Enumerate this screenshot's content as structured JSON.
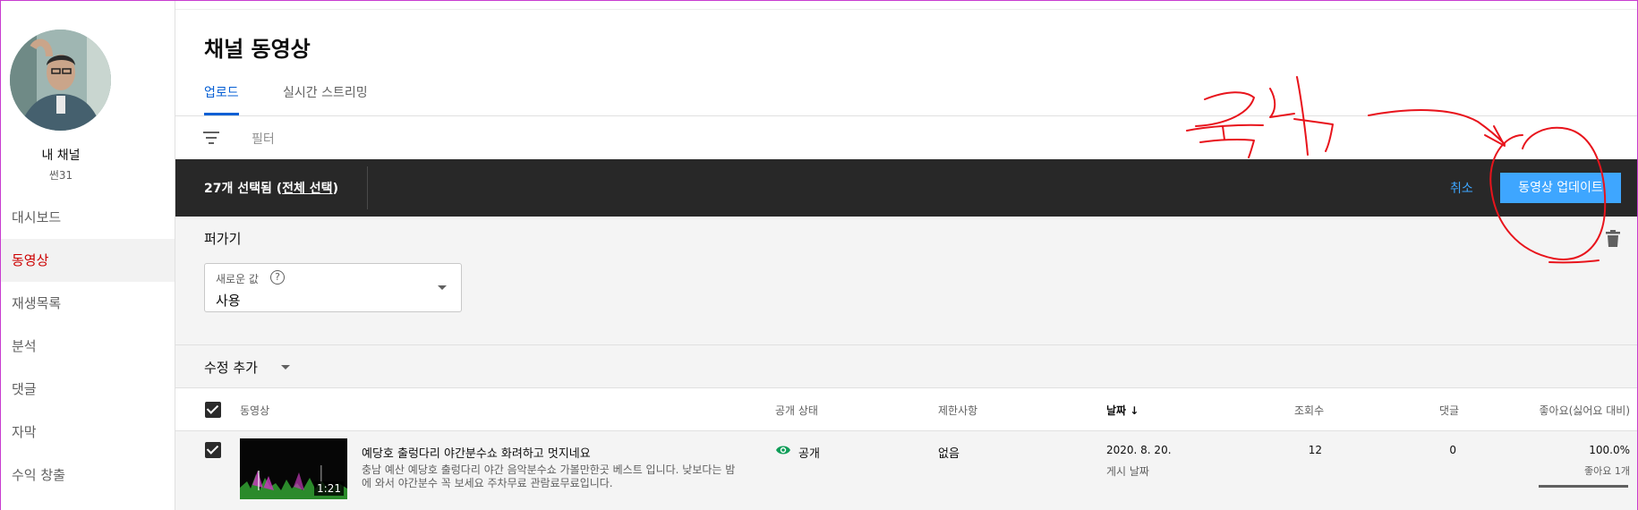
{
  "sidebar": {
    "channel_name": "내 채널",
    "channel_sub": "썬31",
    "items": [
      {
        "label": "대시보드"
      },
      {
        "label": "동영상"
      },
      {
        "label": "재생목록"
      },
      {
        "label": "분석"
      },
      {
        "label": "댓글"
      },
      {
        "label": "자막"
      },
      {
        "label": "수익 창출"
      }
    ]
  },
  "header": {
    "title": "채널 동영상"
  },
  "tabs": [
    {
      "label": "업로드"
    },
    {
      "label": "실시간 스트리밍"
    }
  ],
  "filter": {
    "label": "필터"
  },
  "selection_bar": {
    "count_text": "27개 선택됨 (",
    "select_all": "전체 선택",
    "close_paren": ")",
    "cancel": "취소",
    "update": "동영상 업데이트"
  },
  "edit_panel": {
    "label": "퍼가기",
    "select_caption": "새로운 값",
    "select_value": "사용",
    "help_glyph": "?"
  },
  "add_edit": {
    "label": "수정 추가"
  },
  "table": {
    "headers": {
      "video": "동영상",
      "visibility": "공개 상태",
      "restrictions": "제한사항",
      "date": "날짜",
      "sort_arrow": "↓",
      "views": "조회수",
      "comments": "댓글",
      "likes": "좋아요(싫어요 대비)"
    },
    "rows": [
      {
        "duration": "1:21",
        "title": "예당호 출렁다리 야간분수쇼 화려하고 멋지네요",
        "description": "충남 예산 예당호 출렁다리 야간 음악분수쇼 가볼만한곳 베스트 입니다. 낮보다는 밤에 와서 야간분수 꼭 보세요 주차무료 관람료무료입니다.",
        "visibility": "공개",
        "restrictions": "없음",
        "date": "2020. 8. 20.",
        "date_sub": "게시 날짜",
        "views": "12",
        "comments": "0",
        "likes_pct": "100.0%",
        "likes_sub": "좋아요 1개",
        "likes_ratio": 1.0
      }
    ]
  },
  "annotation": {
    "text": "클릭",
    "color": "#e8141c"
  },
  "colors": {
    "accent_blue": "#3ea6ff",
    "active_red": "#cc0000",
    "tab_blue": "#065fd4",
    "visibility_green": "#0f9d58"
  }
}
